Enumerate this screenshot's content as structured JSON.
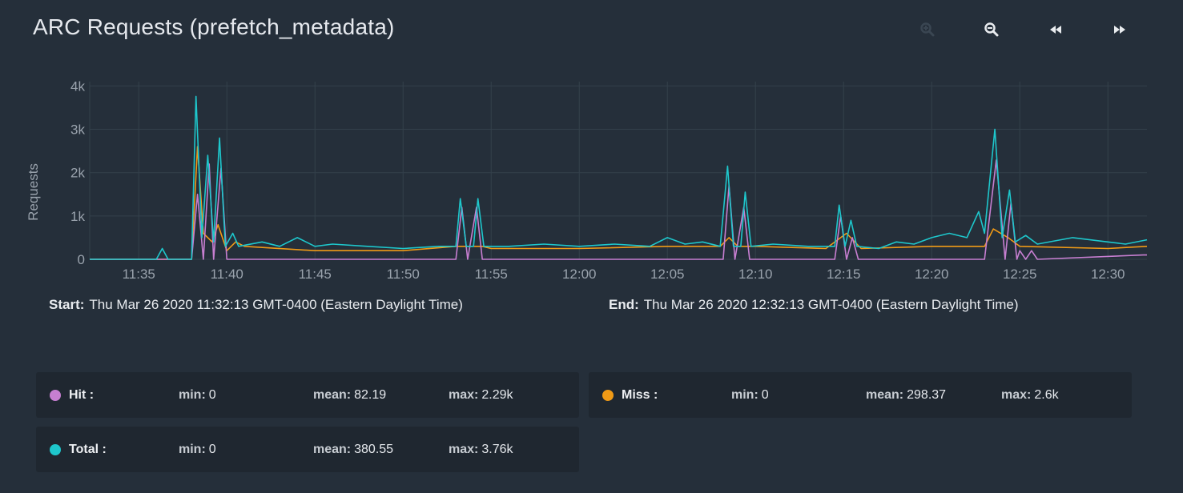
{
  "title": "ARC Requests (prefetch_metadata)",
  "toolbar": [
    {
      "name": "zoom-in-button",
      "icon": "zoom-in-icon",
      "enabled": false
    },
    {
      "name": "zoom-out-button",
      "icon": "zoom-out-icon",
      "enabled": true
    },
    {
      "name": "step-back-button",
      "icon": "rewind-icon",
      "enabled": true
    },
    {
      "name": "step-forward-button",
      "icon": "fast-forward-icon",
      "enabled": true
    }
  ],
  "range": {
    "start_label": "Start:",
    "start_value": "Thu Mar 26 2020 11:32:13 GMT-0400 (Eastern Daylight Time)",
    "end_label": "End:",
    "end_value": "Thu Mar 26 2020 12:32:13 GMT-0400 (Eastern Daylight Time)"
  },
  "colors": {
    "hit": "#c77fd1",
    "miss": "#f09a16",
    "total": "#1ec7cc",
    "grid": "#34404b",
    "axis_text": "#9aa3ad"
  },
  "stats": [
    {
      "series": "Hit :",
      "color": "#c77fd1",
      "min_label": "min:",
      "min": "0",
      "mean_label": "mean:",
      "mean": "82.19",
      "max_label": "max:",
      "max": "2.29k"
    },
    {
      "series": "Miss :",
      "color": "#f09a16",
      "min_label": "min:",
      "min": "0",
      "mean_label": "mean:",
      "mean": "298.37",
      "max_label": "max:",
      "max": "2.6k"
    },
    {
      "series": "Total :",
      "color": "#1ec7cc",
      "min_label": "min:",
      "min": "0",
      "mean_label": "mean:",
      "mean": "380.55",
      "max_label": "max:",
      "max": "3.76k"
    }
  ],
  "chart_data": {
    "type": "line",
    "ylabel": "Requests",
    "xlabel": "",
    "x_domain": [
      "11:32:13",
      "12:32:13"
    ],
    "ylim": [
      0,
      4100
    ],
    "y_ticks": [
      {
        "v": 0,
        "label": "0"
      },
      {
        "v": 1000,
        "label": "1k"
      },
      {
        "v": 2000,
        "label": "2k"
      },
      {
        "v": 3000,
        "label": "3k"
      },
      {
        "v": 4000,
        "label": "4k"
      }
    ],
    "x_ticks": [
      "11:35",
      "11:40",
      "11:45",
      "11:50",
      "11:55",
      "12:00",
      "12:05",
      "12:10",
      "12:15",
      "12:20",
      "12:25",
      "12:30"
    ],
    "grid": true,
    "series": [
      {
        "name": "Hit",
        "key": "hit",
        "points": [
          [
            "11:32:13",
            0
          ],
          [
            "11:38:00",
            0
          ],
          [
            "11:38:20",
            1500
          ],
          [
            "11:38:40",
            0
          ],
          [
            "11:39:00",
            2200
          ],
          [
            "11:39:15",
            0
          ],
          [
            "11:39:40",
            2100
          ],
          [
            "11:40:00",
            0
          ],
          [
            "11:53:00",
            0
          ],
          [
            "11:53:20",
            1200
          ],
          [
            "11:53:40",
            0
          ],
          [
            "11:54:10",
            1200
          ],
          [
            "11:54:30",
            0
          ],
          [
            "12:08:10",
            0
          ],
          [
            "12:08:30",
            1700
          ],
          [
            "12:08:50",
            0
          ],
          [
            "12:09:20",
            1200
          ],
          [
            "12:09:40",
            0
          ],
          [
            "12:14:30",
            0
          ],
          [
            "12:14:50",
            1000
          ],
          [
            "12:15:10",
            0
          ],
          [
            "12:15:30",
            500
          ],
          [
            "12:15:50",
            0
          ],
          [
            "12:23:00",
            0
          ],
          [
            "12:23:40",
            2290
          ],
          [
            "12:24:10",
            0
          ],
          [
            "12:24:30",
            1300
          ],
          [
            "12:24:50",
            0
          ],
          [
            "12:25:00",
            200
          ],
          [
            "12:25:20",
            0
          ],
          [
            "12:25:40",
            200
          ],
          [
            "12:26:00",
            0
          ],
          [
            "12:32:00",
            100
          ],
          [
            "12:32:13",
            100
          ]
        ]
      },
      {
        "name": "Miss",
        "key": "miss",
        "points": [
          [
            "11:32:13",
            0
          ],
          [
            "11:38:00",
            0
          ],
          [
            "11:38:20",
            2600
          ],
          [
            "11:38:40",
            600
          ],
          [
            "11:39:10",
            400
          ],
          [
            "11:39:30",
            800
          ],
          [
            "11:40:00",
            200
          ],
          [
            "11:40:30",
            400
          ],
          [
            "11:41:00",
            300
          ],
          [
            "11:45:00",
            200
          ],
          [
            "11:50:00",
            200
          ],
          [
            "11:53:00",
            300
          ],
          [
            "11:54:30",
            300
          ],
          [
            "11:55:00",
            250
          ],
          [
            "12:00:00",
            250
          ],
          [
            "12:05:00",
            300
          ],
          [
            "12:08:00",
            300
          ],
          [
            "12:08:30",
            500
          ],
          [
            "12:09:00",
            300
          ],
          [
            "12:10:00",
            300
          ],
          [
            "12:14:00",
            250
          ],
          [
            "12:15:10",
            600
          ],
          [
            "12:16:00",
            250
          ],
          [
            "12:20:00",
            300
          ],
          [
            "12:23:00",
            300
          ],
          [
            "12:23:30",
            700
          ],
          [
            "12:24:20",
            500
          ],
          [
            "12:25:00",
            300
          ],
          [
            "12:30:00",
            250
          ],
          [
            "12:32:13",
            300
          ]
        ]
      },
      {
        "name": "Total",
        "key": "total",
        "points": [
          [
            "11:32:13",
            0
          ],
          [
            "11:36:00",
            0
          ],
          [
            "11:36:20",
            250
          ],
          [
            "11:36:40",
            0
          ],
          [
            "11:38:00",
            0
          ],
          [
            "11:38:15",
            3760
          ],
          [
            "11:38:35",
            500
          ],
          [
            "11:38:55",
            2400
          ],
          [
            "11:39:15",
            400
          ],
          [
            "11:39:35",
            2800
          ],
          [
            "11:39:55",
            300
          ],
          [
            "11:40:20",
            600
          ],
          [
            "11:40:40",
            300
          ],
          [
            "11:42:00",
            400
          ],
          [
            "11:43:00",
            300
          ],
          [
            "11:44:00",
            500
          ],
          [
            "11:45:00",
            300
          ],
          [
            "11:46:00",
            350
          ],
          [
            "11:48:00",
            300
          ],
          [
            "11:50:00",
            250
          ],
          [
            "11:52:00",
            300
          ],
          [
            "11:53:00",
            300
          ],
          [
            "11:53:15",
            1400
          ],
          [
            "11:53:35",
            300
          ],
          [
            "11:54:00",
            300
          ],
          [
            "11:54:15",
            1400
          ],
          [
            "11:54:35",
            300
          ],
          [
            "11:56:00",
            300
          ],
          [
            "11:58:00",
            350
          ],
          [
            "12:00:00",
            300
          ],
          [
            "12:02:00",
            350
          ],
          [
            "12:04:00",
            300
          ],
          [
            "12:05:00",
            500
          ],
          [
            "12:06:00",
            350
          ],
          [
            "12:07:00",
            400
          ],
          [
            "12:08:00",
            300
          ],
          [
            "12:08:25",
            2150
          ],
          [
            "12:08:45",
            300
          ],
          [
            "12:09:10",
            300
          ],
          [
            "12:09:25",
            1550
          ],
          [
            "12:09:45",
            300
          ],
          [
            "12:11:00",
            350
          ],
          [
            "12:13:00",
            300
          ],
          [
            "12:14:30",
            300
          ],
          [
            "12:14:45",
            1250
          ],
          [
            "12:15:05",
            300
          ],
          [
            "12:15:25",
            900
          ],
          [
            "12:15:45",
            300
          ],
          [
            "12:17:00",
            250
          ],
          [
            "12:18:00",
            400
          ],
          [
            "12:19:00",
            350
          ],
          [
            "12:20:00",
            500
          ],
          [
            "12:21:00",
            600
          ],
          [
            "12:22:00",
            500
          ],
          [
            "12:22:40",
            1100
          ],
          [
            "12:23:00",
            600
          ],
          [
            "12:23:35",
            3000
          ],
          [
            "12:24:00",
            500
          ],
          [
            "12:24:25",
            1600
          ],
          [
            "12:24:45",
            400
          ],
          [
            "12:25:20",
            550
          ],
          [
            "12:26:00",
            350
          ],
          [
            "12:28:00",
            500
          ],
          [
            "12:30:00",
            400
          ],
          [
            "12:31:00",
            350
          ],
          [
            "12:32:13",
            450
          ]
        ]
      }
    ]
  }
}
